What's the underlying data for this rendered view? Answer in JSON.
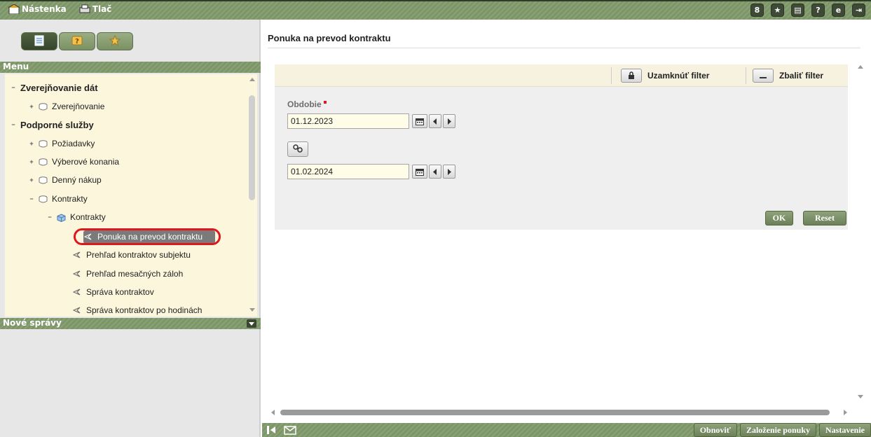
{
  "topbar": {
    "nastenka_label": "Nástenka",
    "tlac_label": "Tlač",
    "right_icons": [
      "notes-icon",
      "star-icon",
      "calculator-icon",
      "help-icon",
      "refresh-icon",
      "logout-icon"
    ]
  },
  "sidebar": {
    "tabs": [
      "list-icon",
      "help-icon",
      "star-icon"
    ],
    "menu_header": "Menu",
    "news_header": "Nové správy",
    "tree": [
      {
        "label": "Zverejňovanie dát",
        "level": 0,
        "state": "expanded"
      },
      {
        "label": "Zverejňovanie",
        "level": 1,
        "state": "collapsed"
      },
      {
        "label": "Podporné služby",
        "level": 0,
        "state": "expanded"
      },
      {
        "label": "Požiadavky",
        "level": 1,
        "state": "collapsed"
      },
      {
        "label": "Výberové konania",
        "level": 1,
        "state": "collapsed"
      },
      {
        "label": "Denný nákup",
        "level": 1,
        "state": "collapsed"
      },
      {
        "label": "Kontrakty",
        "level": 1,
        "state": "expanded"
      },
      {
        "label": "Kontrakty",
        "level": 2,
        "state": "expanded"
      },
      {
        "label": "Ponuka na prevod kontraktu",
        "level": 3,
        "state": "selected"
      },
      {
        "label": "Prehľad kontraktov subjektu",
        "level": 3,
        "state": "leaf"
      },
      {
        "label": "Prehľad mesačných záloh",
        "level": 3,
        "state": "leaf"
      },
      {
        "label": "Správa kontraktov",
        "level": 3,
        "state": "leaf"
      },
      {
        "label": "Správa kontraktov po hodinách",
        "level": 3,
        "state": "leaf"
      }
    ]
  },
  "main": {
    "title": "Ponuka na prevod kontraktu",
    "filter": {
      "lock_label": "Uzamknúť filter",
      "collapse_label": "Zbaliť filter",
      "period_label": "Obdobie",
      "date_from": "01.12.2023",
      "date_to": "01.02.2024",
      "ok_label": "OK",
      "reset_label": "Reset"
    }
  },
  "bottombar": {
    "obnovit_label": "Obnoviť",
    "zalozenie_label": "Založenie ponuky",
    "nastavenie_label": "Nastavenie"
  },
  "colors": {
    "header_green": "#7d9668",
    "dark_green": "#3e4a35",
    "menu_bg": "#fbf6dc",
    "highlight_red": "#e0161e"
  }
}
